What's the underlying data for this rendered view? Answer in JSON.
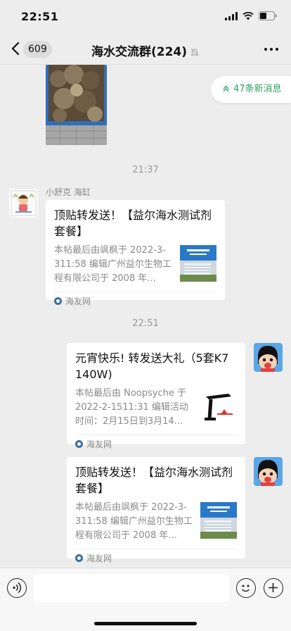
{
  "status": {
    "time": "22:51"
  },
  "nav": {
    "back_count": "609",
    "title": "海水交流群(224)"
  },
  "new_messages": {
    "label": "47条新消息"
  },
  "timestamps": [
    "21:37",
    "22:51"
  ],
  "messages": [
    {
      "sender": "小舒克 海缸",
      "title": "顶贴转发送！【益尔海水测试剂套餐】",
      "desc": "本帖最后由飒枫于 2022-3-311:58 编辑广州益尔生物工程有限公司于 2008 年...",
      "source": "海友网"
    },
    {
      "title": "元宵快乐! 转发送大礼（5套K7 140W)",
      "desc": "本帖最后由 Noopsyche 于 2022-2-1511:31 编辑活动时间：2月15日到3月14...",
      "source": "海友网"
    },
    {
      "title": "顶贴转发送！【益尔海水测试剂套餐】",
      "desc": "本帖最后由飒枫于 2022-3-311:58 编辑广州益尔生物工程有限公司于 2008 年...",
      "source": "海友网"
    }
  ],
  "colors": {
    "accent_green": "#2e9f5e",
    "chat_bg": "#ededed"
  }
}
